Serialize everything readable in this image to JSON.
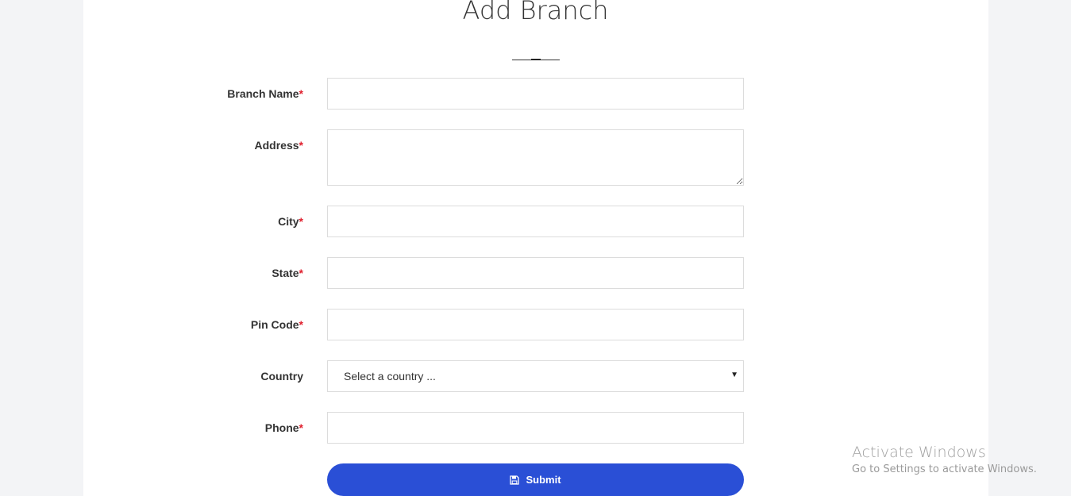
{
  "page": {
    "title": "Add Branch"
  },
  "form": {
    "required_marker": "*",
    "fields": {
      "branch_name": {
        "label": "Branch Name",
        "value": ""
      },
      "address": {
        "label": "Address",
        "value": ""
      },
      "city": {
        "label": "City",
        "value": ""
      },
      "state": {
        "label": "State",
        "value": ""
      },
      "pin_code": {
        "label": "Pin Code",
        "value": ""
      },
      "country": {
        "label": "Country",
        "selected": "Select a country ..."
      },
      "phone": {
        "label": "Phone",
        "value": ""
      }
    },
    "submit": {
      "label": "Submit",
      "icon": "save-icon",
      "color": "#2a4fd6"
    }
  },
  "watermark": {
    "title": "Activate Windows",
    "subtitle": "Go to Settings to activate Windows."
  },
  "colors": {
    "required": "#e0202e",
    "background": "#f3f4f6",
    "panel": "#ffffff"
  }
}
